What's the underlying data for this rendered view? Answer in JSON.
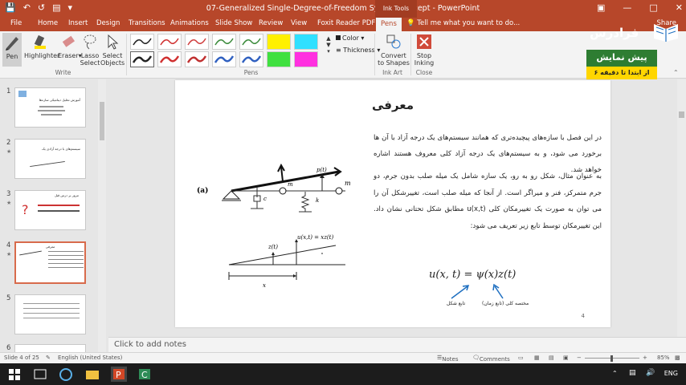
{
  "window": {
    "title": "07-Generalized  Single-Degree-of-Freedom Systems-accept  -  PowerPoint",
    "context_tab": "Ink Tools",
    "share_label": "Share"
  },
  "tabs": [
    "File",
    "Home",
    "Insert",
    "Design",
    "Transitions",
    "Animations",
    "Slide Show",
    "Review",
    "View",
    "Foxit Reader PDF",
    "Pens"
  ],
  "tell_me": "Tell me what you want to do...",
  "ribbon": {
    "write_group": "Write",
    "pens_group": "Pens",
    "inkart_group": "Ink Art",
    "close_group": "Close",
    "pen": "Pen",
    "highlighter": "Highlighter",
    "eraser": "Eraser",
    "lasso_1": "Lasso",
    "lasso_2": "Select",
    "select_1": "Select",
    "select_2": "Objects",
    "color": "Color",
    "thickness": "Thickness",
    "convert_1": "Convert",
    "convert_2": "to Shapes",
    "stop_1": "Stop",
    "stop_2": "Inking"
  },
  "promo": {
    "title": "پیش نمایش",
    "subtitle": "از ابتدا تا دقیقه ۶"
  },
  "logo_text": "فرادرس",
  "thumbnails": [
    {
      "num": "1",
      "title": "آموزش تحلیل دینامیکی سازه‌ها"
    },
    {
      "num": "2",
      "title": "سیستم‌های با درجه آزادی یک"
    },
    {
      "num": "3",
      "title": "مرور بر درس قبل"
    },
    {
      "num": "4",
      "title": "معرفی"
    },
    {
      "num": "5",
      "title": ""
    },
    {
      "num": "6",
      "title": ""
    }
  ],
  "slide": {
    "heading": "معرفی",
    "para1": "در این فصل با سازه‌های پیچیده‌تری که همانند سیستم‌های یک درجه آزاد با آن ها برخورد می شود، و به سیستم‌های یک درجه آزاد کلی معروف هستند اشاره خواهد شد.",
    "para2": "به عنوان مثال، شکل رو به رو، یک سازه شامل یک میله صلب بدون جرم، دو جرم متمرکز، فنر و میراگر است. از آنجا که میله صلب است، تغییرشکل آن را می توان به صورت یک تغییرمکان کلی u(x,t) مطابق شکل تحتانی نشان داد. این تغییرمکان توسط تابع زیر تعریف می شود:",
    "equation": "u(x, t) = ψ(x)z(t)",
    "label_shape": "تابع شکل",
    "label_coord": "مختصه کلی (تابع زمان)",
    "fig_a": "(a)",
    "fig_pt": "p(t)",
    "fig_m1": "m",
    "fig_m2": "m",
    "fig_c": "c",
    "fig_k": "k",
    "fig_zt": "z(t)",
    "fig_uxt": "u(x,t) = xz(t)",
    "fig_x": "x",
    "page": "4"
  },
  "notes_placeholder": "Click to add notes",
  "status": {
    "slide_info": "Slide 4 of 25",
    "language": "English (United States)",
    "notes": "Notes",
    "comments": "Comments",
    "zoom": "85%"
  },
  "taskbar": {
    "lang": "ENG"
  },
  "colors": {
    "accent": "#b7472a",
    "promo_green": "#2e7d32",
    "promo_yellow": "#ffd600",
    "annotation_blue": "#1e6fc0"
  }
}
